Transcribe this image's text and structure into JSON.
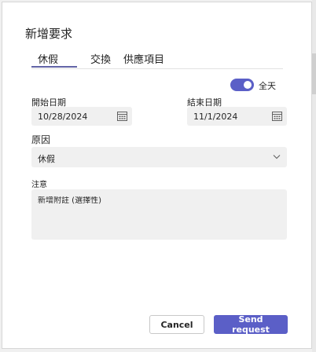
{
  "dialog": {
    "title": "新增要求",
    "tabs": [
      {
        "label": "休假",
        "active": true
      },
      {
        "label": "交換",
        "active": false
      },
      {
        "label": "供應項目",
        "active": false
      }
    ],
    "all_day": {
      "label": "全天",
      "checked": true
    },
    "start_date": {
      "label": "開始日期",
      "value": "10/28/2024"
    },
    "end_date": {
      "label": "結束日期",
      "value": "11/1/2024"
    },
    "reason": {
      "label": "原因",
      "value": "休假"
    },
    "note": {
      "label": "注意",
      "placeholder": "新增附註 (選擇性)"
    },
    "buttons": {
      "cancel": "Cancel",
      "send": "Send request"
    }
  },
  "colors": {
    "accent": "#5b5fc7",
    "field_bg": "#f0f0f0"
  },
  "icons": {
    "date": "calendar-icon",
    "dropdown": "chevron-down-icon"
  }
}
